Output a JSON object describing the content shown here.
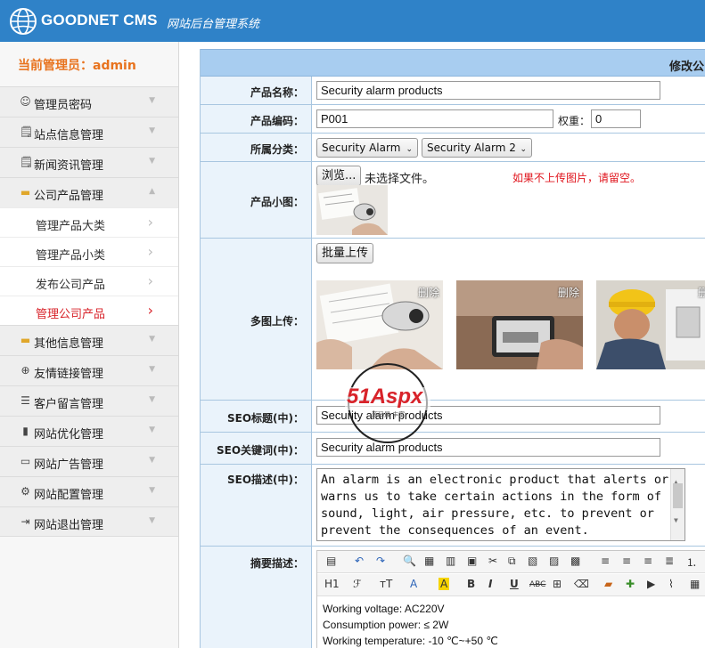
{
  "header": {
    "brand": "GOODNET CMS",
    "subtitle": "网站后台管理系统"
  },
  "sidebar": {
    "admin_label": "当前管理员：admin",
    "items": [
      {
        "label": "管理员密码",
        "icon": "user-icon"
      },
      {
        "label": "站点信息管理",
        "icon": "document-icon"
      },
      {
        "label": "新闻资讯管理",
        "icon": "document-icon"
      },
      {
        "label": "公司产品管理",
        "icon": "folder-icon",
        "expanded": true,
        "children": [
          {
            "label": "管理产品大类"
          },
          {
            "label": "管理产品小类"
          },
          {
            "label": "发布公司产品"
          },
          {
            "label": "管理公司产品",
            "active": true
          }
        ]
      },
      {
        "label": "其他信息管理",
        "icon": "folder-icon"
      },
      {
        "label": "友情链接管理",
        "icon": "globe-icon"
      },
      {
        "label": "客户留言管理",
        "icon": "list-icon"
      },
      {
        "label": "网站优化管理",
        "icon": "bar-chart-icon"
      },
      {
        "label": "网站广告管理",
        "icon": "monitor-icon"
      },
      {
        "label": "网站配置管理",
        "icon": "gear-icon"
      },
      {
        "label": "网站退出管理",
        "icon": "exit-icon"
      }
    ]
  },
  "form": {
    "title": "修改公",
    "name": {
      "label": "产品名称：",
      "value": "Security alarm products"
    },
    "code": {
      "label": "产品编码：",
      "value": "P001",
      "weight_label": "权重：",
      "weight_value": "0"
    },
    "category": {
      "label": "所属分类：",
      "main": "Security Alarm",
      "sub": "Security Alarm 2"
    },
    "thumb": {
      "label": "产品小图：",
      "browse": "浏览...",
      "no_file": "未选择文件。",
      "hint": "如果不上传图片，请留空。"
    },
    "multi": {
      "label": "多图上传：",
      "batch_button": "批量上传",
      "delete_label": "删除"
    },
    "seo_title": {
      "label": "SEO标题(中)：",
      "value": "Security alarm products"
    },
    "seo_keywords": {
      "label": "SEO关键词(中)：",
      "value": "Security alarm products"
    },
    "seo_desc": {
      "label": "SEO描述(中)：",
      "lines": [
        "An alarm is an electronic product that alerts or",
        "warns us to take certain actions in the form of",
        "sound, light, air pressure, etc. to prevent or",
        "prevent the consequences of an event."
      ]
    },
    "summary": {
      "label": "摘要描述：",
      "lines": [
        "Working voltage: AC220V",
        "Consumption power: ≤ 2W",
        "Working temperature: -10 ℃~+50 ℃"
      ],
      "toolbar_heading": "H1",
      "toolbar_font": "ℱ",
      "toolbar_size": "тT",
      "toolbar_color": "A",
      "toolbar_bold": "B",
      "toolbar_italic": "I",
      "toolbar_underline": "U",
      "toolbar_strike": "ABC"
    }
  },
  "watermark": {
    "text": "51Aspx",
    "sub": "源码最 丰富"
  }
}
